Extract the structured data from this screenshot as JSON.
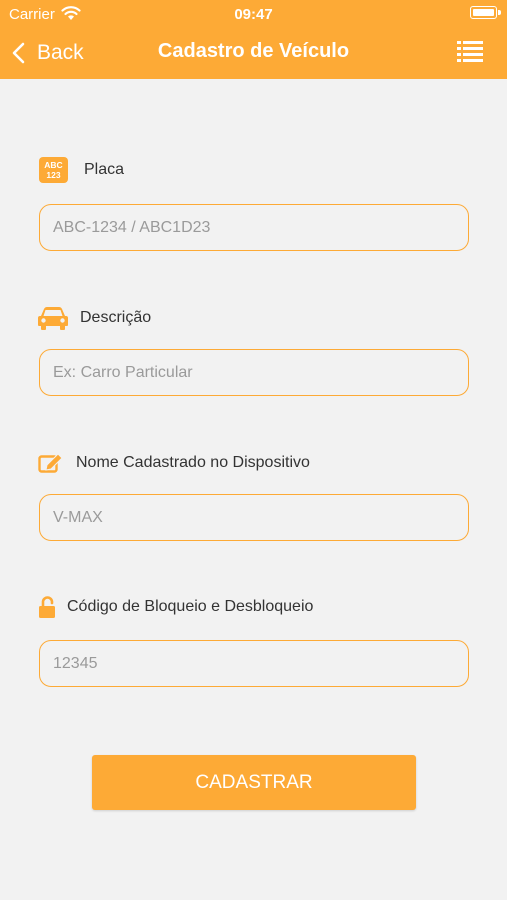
{
  "status_bar": {
    "carrier": "Carrier",
    "time": "09:47"
  },
  "nav": {
    "back_label": "Back",
    "title": "Cadastro de Veículo",
    "list_icon": "list-icon"
  },
  "form": {
    "placa": {
      "label": "Placa",
      "icon": "license-plate-icon",
      "icon_text": [
        "ABC",
        "123"
      ],
      "placeholder": "ABC-1234 / ABC1D23"
    },
    "descricao": {
      "label": "Descrição",
      "icon": "car-icon",
      "placeholder": "Ex: Carro Particular"
    },
    "nome_dispositivo": {
      "label": "Nome Cadastrado no Dispositivo",
      "icon": "edit-icon",
      "placeholder": "V-MAX"
    },
    "codigo": {
      "label": "Código de Bloqueio e Desbloqueio",
      "icon": "unlock-icon",
      "placeholder": "12345"
    },
    "submit_label": "CADASTRAR"
  },
  "colors": {
    "accent": "#fdaa36",
    "background": "#f2f2f2",
    "text": "#333333",
    "placeholder": "#9a9a9a"
  }
}
